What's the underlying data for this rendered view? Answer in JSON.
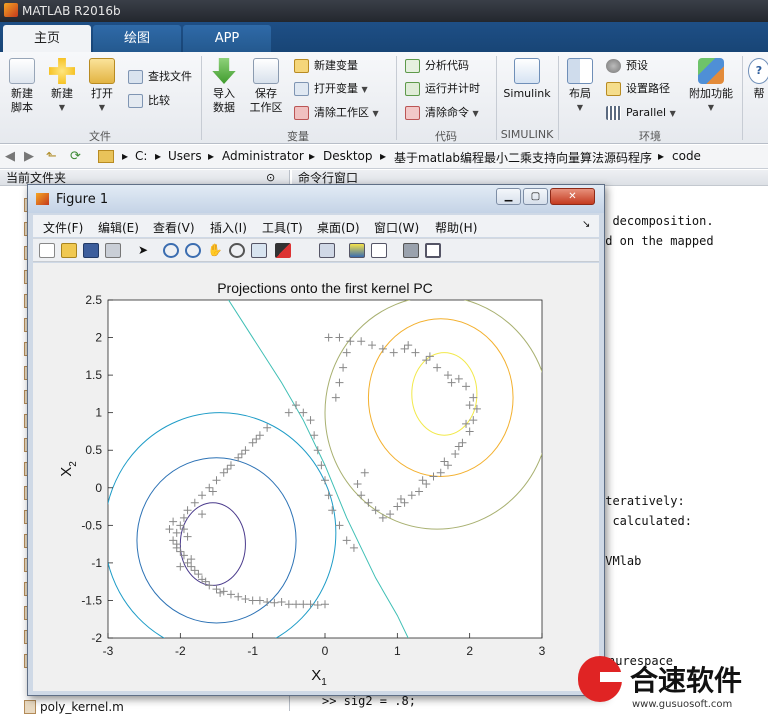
{
  "app": {
    "title": "MATLAB R2016b"
  },
  "tabs": [
    {
      "label": "主页"
    },
    {
      "label": "绘图"
    },
    {
      "label": "APP"
    }
  ],
  "ribbon": {
    "file": {
      "new_script": "新建\n脚本",
      "new": "新建",
      "open": "打开",
      "find_files": "查找文件",
      "compare": "比较",
      "section": "文件"
    },
    "variable": {
      "import_data": "导入\n数据",
      "save_workspace": "保存\n工作区",
      "new_variable": "新建变量",
      "open_variable": "打开变量",
      "clear_workspace": "清除工作区",
      "section": "变量"
    },
    "code": {
      "analyze_code": "分析代码",
      "run_and_time": "运行并计时",
      "clear_commands": "清除命令",
      "section": "代码"
    },
    "simulink": {
      "simulink": "Simulink",
      "section": "SIMULINK"
    },
    "environment": {
      "layout": "布局",
      "preferences": "预设",
      "set_path": "设置路径",
      "parallel": "Parallel",
      "addons": "附加功能",
      "section": "环境"
    },
    "help": "帮"
  },
  "address": {
    "parts": [
      "C:",
      "Users",
      "Administrator",
      "Desktop",
      "基于matlab编程最小二乘支持向量算法源码程序",
      "code"
    ]
  },
  "left_panel": {
    "title": "当前文件夹",
    "last_file": "poly_kernel.m"
  },
  "command_window": {
    "title": "命令行窗口",
    "lines": [
      "r decomposition.",
      "ed on the mapped",
      "iteratively:",
      "s calculated:",
      "SVMlab",
      "nurespace",
      ">> sig2 = .8;"
    ]
  },
  "figure": {
    "title": "Figure 1",
    "menu": [
      "文件(F)",
      "编辑(E)",
      "查看(V)",
      "插入(I)",
      "工具(T)",
      "桌面(D)",
      "窗口(W)",
      "帮助(H)"
    ],
    "toolbar_icons": [
      "new-figure-icon",
      "open-icon",
      "save-icon",
      "print-icon",
      "pointer-icon",
      "zoom-in-icon",
      "zoom-out-icon",
      "pan-icon",
      "rotate-icon",
      "data-cursor-icon",
      "brush-icon",
      "link-icon",
      "colorbar-icon",
      "legend-icon",
      "hide-tools-icon",
      "dock-icon"
    ]
  },
  "chart_data": {
    "type": "scatter",
    "title": "Projections onto the first kernel PC",
    "xlabel": "X",
    "xlabel_sub": "1",
    "ylabel": "X",
    "ylabel_sub": "2",
    "xlim": [
      -3,
      3
    ],
    "ylim": [
      -2,
      2.5
    ],
    "xticks": [
      -3,
      -2,
      -1,
      0,
      1,
      2,
      3
    ],
    "yticks": [
      -2,
      -1.5,
      -1,
      -0.5,
      0,
      0.5,
      1,
      1.5,
      2,
      2.5
    ],
    "marker": "+",
    "marker_color": "#888888",
    "points": [
      [
        -1.0,
        -1.5
      ],
      [
        -0.9,
        -1.5
      ],
      [
        -0.8,
        -1.52
      ],
      [
        -0.7,
        -1.53
      ],
      [
        -0.6,
        -1.52
      ],
      [
        -0.5,
        -1.55
      ],
      [
        -0.4,
        -1.55
      ],
      [
        -0.3,
        -1.55
      ],
      [
        -0.2,
        -1.55
      ],
      [
        -0.1,
        -1.56
      ],
      [
        0.0,
        -1.55
      ],
      [
        -1.1,
        -1.48
      ],
      [
        -1.2,
        -1.45
      ],
      [
        -1.3,
        -1.42
      ],
      [
        -1.4,
        -1.38
      ],
      [
        -1.5,
        -1.35
      ],
      [
        -1.6,
        -1.3
      ],
      [
        -1.7,
        -1.22
      ],
      [
        -1.75,
        -1.15
      ],
      [
        -1.8,
        -1.1
      ],
      [
        -1.85,
        -1.05
      ],
      [
        -1.9,
        -1.0
      ],
      [
        -1.95,
        -0.9
      ],
      [
        -2.0,
        -0.85
      ],
      [
        -2.05,
        -0.8
      ],
      [
        -2.1,
        -0.7
      ],
      [
        -2.05,
        -0.6
      ],
      [
        -2.0,
        -0.5
      ],
      [
        -1.95,
        -0.4
      ],
      [
        -2.1,
        -0.45
      ],
      [
        -2.15,
        -0.55
      ],
      [
        -1.9,
        -0.3
      ],
      [
        -1.8,
        -0.2
      ],
      [
        -1.7,
        -0.1
      ],
      [
        -1.6,
        0.0
      ],
      [
        -1.5,
        0.1
      ],
      [
        -1.4,
        0.2
      ],
      [
        -1.3,
        0.3
      ],
      [
        -1.2,
        0.4
      ],
      [
        -1.1,
        0.5
      ],
      [
        -1.0,
        0.6
      ],
      [
        -0.9,
        0.7
      ],
      [
        -0.8,
        0.8
      ],
      [
        -1.45,
        -1.4
      ],
      [
        -1.85,
        -0.95
      ],
      [
        -1.65,
        -1.25
      ],
      [
        -1.9,
        -0.65
      ],
      [
        -1.55,
        -0.05
      ],
      [
        -2.0,
        -1.05
      ],
      [
        -1.7,
        -0.35
      ],
      [
        -1.35,
        0.25
      ],
      [
        -1.15,
        0.45
      ],
      [
        -0.95,
        0.65
      ],
      [
        -0.5,
        1.0
      ],
      [
        -0.4,
        1.1
      ],
      [
        -0.3,
        1.0
      ],
      [
        -0.2,
        0.9
      ],
      [
        -0.15,
        0.7
      ],
      [
        -0.1,
        0.5
      ],
      [
        -0.05,
        0.3
      ],
      [
        0.0,
        0.1
      ],
      [
        0.05,
        -0.1
      ],
      [
        0.1,
        -0.3
      ],
      [
        0.2,
        -0.5
      ],
      [
        0.3,
        -0.7
      ],
      [
        0.4,
        -0.8
      ],
      [
        0.15,
        1.2
      ],
      [
        0.2,
        1.4
      ],
      [
        0.25,
        1.6
      ],
      [
        0.3,
        1.8
      ],
      [
        0.05,
        2.0
      ],
      [
        0.2,
        2.0
      ],
      [
        0.35,
        1.95
      ],
      [
        0.5,
        1.95
      ],
      [
        0.65,
        1.9
      ],
      [
        0.8,
        1.85
      ],
      [
        0.95,
        1.8
      ],
      [
        1.1,
        1.85
      ],
      [
        1.25,
        1.8
      ],
      [
        1.4,
        1.7
      ],
      [
        1.55,
        1.6
      ],
      [
        1.7,
        1.5
      ],
      [
        1.85,
        1.45
      ],
      [
        1.95,
        1.35
      ],
      [
        2.05,
        1.2
      ],
      [
        2.1,
        1.05
      ],
      [
        2.05,
        0.9
      ],
      [
        2.0,
        0.75
      ],
      [
        1.9,
        0.6
      ],
      [
        1.8,
        0.45
      ],
      [
        1.7,
        0.3
      ],
      [
        1.6,
        0.2
      ],
      [
        1.5,
        0.15
      ],
      [
        1.4,
        0.05
      ],
      [
        1.3,
        -0.05
      ],
      [
        1.2,
        -0.1
      ],
      [
        1.1,
        -0.2
      ],
      [
        1.0,
        -0.25
      ],
      [
        0.9,
        -0.35
      ],
      [
        0.8,
        -0.4
      ],
      [
        1.15,
        1.9
      ],
      [
        1.45,
        1.75
      ],
      [
        1.75,
        1.4
      ],
      [
        2.0,
        1.1
      ],
      [
        1.95,
        0.85
      ],
      [
        1.85,
        0.55
      ],
      [
        1.65,
        0.35
      ],
      [
        1.35,
        0.1
      ],
      [
        1.05,
        -0.15
      ],
      [
        0.7,
        -0.3
      ],
      [
        0.6,
        -0.2
      ],
      [
        0.5,
        -0.1
      ],
      [
        0.45,
        0.05
      ],
      [
        0.55,
        0.2
      ],
      [
        -2.05,
        -0.75
      ],
      [
        -1.95,
        -0.55
      ]
    ],
    "contours": [
      {
        "cx": -1.55,
        "cy": -0.75,
        "rx": 0.45,
        "ry": 0.55,
        "color": "#4a3a8c"
      },
      {
        "cx": -1.5,
        "cy": -0.7,
        "rx": 1.1,
        "ry": 1.1,
        "color": "#2c72b5"
      },
      {
        "cx": -1.45,
        "cy": -0.6,
        "rx": 1.6,
        "ry": 1.6,
        "color": "#1e9cc7"
      },
      {
        "cx": 1.65,
        "cy": 1.25,
        "rx": 0.45,
        "ry": 0.55,
        "color": "#f2e94a"
      },
      {
        "cx": 1.6,
        "cy": 1.2,
        "rx": 1.0,
        "ry": 1.05,
        "color": "#f3b02e"
      },
      {
        "cx": 1.55,
        "cy": 1.0,
        "rx": 1.55,
        "ry": 1.55,
        "color": "#a8b070"
      }
    ]
  },
  "watermark": {
    "text": "合速软件",
    "url": "www.gusuosoft.com"
  }
}
